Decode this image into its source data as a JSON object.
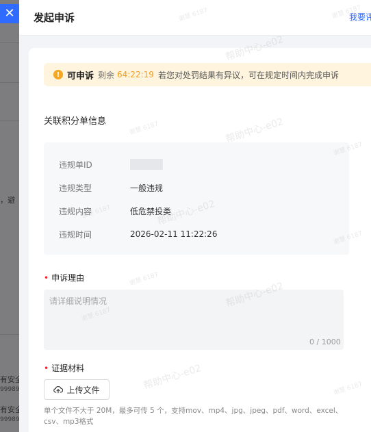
{
  "background": {
    "fragments": [
      "，避",
      "有安全",
      "99989",
      "有安全",
      "99989"
    ]
  },
  "drawer": {
    "title": "发起申诉",
    "header_link": "我要评价",
    "close_icon": "close-icon"
  },
  "alert": {
    "icon": "warning-circle-icon",
    "status": "可申诉",
    "remaining_label": "剩余",
    "countdown": "64:22:19",
    "message": "若您对处罚结果有异议，可在规定时间内完成申诉"
  },
  "related_info": {
    "title": "关联积分单信息",
    "rows": [
      {
        "label": "违规单ID",
        "value": ""
      },
      {
        "label": "违规类型",
        "value": "一般违规"
      },
      {
        "label": "违规内容",
        "value": "低危禁投类"
      },
      {
        "label": "违规时间",
        "value": "2026-02-11 11:22:26"
      }
    ]
  },
  "reason": {
    "label": "申诉理由",
    "placeholder": "请详细说明情况",
    "counter": "0 / 1000"
  },
  "evidence": {
    "label": "证据材料",
    "upload_label": "上传文件",
    "upload_icon": "upload-cloud-icon",
    "tip": "单个文件不大于 20M，最多可传 5 个，支持mov、mp4、jpg、jpeg、pdf、word、excel、csv、mp3格式"
  },
  "watermark": {
    "large": "帮助中心-e02",
    "small": "谢慧 6187"
  },
  "colors": {
    "accent": "#2f6bff",
    "warning": "#f5a623",
    "countdown": "#f0a020",
    "required": "#f5222d",
    "alert_bg": "#fff4dd"
  }
}
